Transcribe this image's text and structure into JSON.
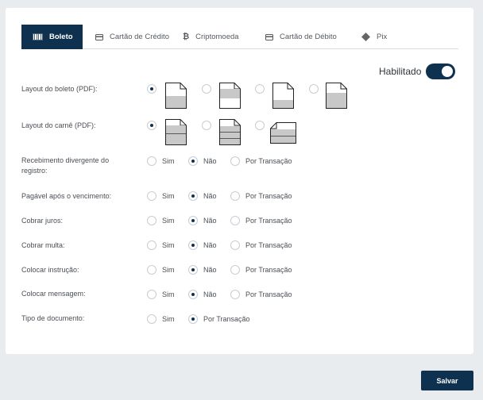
{
  "tabs": [
    {
      "label": "Boleto",
      "icon": "barcode-icon",
      "active": true
    },
    {
      "label": "Cartão de Crédito",
      "icon": "credit-card-icon",
      "active": false
    },
    {
      "label": "Criptomoeda",
      "icon": "bitcoin-icon",
      "active": false
    },
    {
      "label": "Cartão de Débito",
      "icon": "debit-card-icon",
      "active": false
    },
    {
      "label": "Pix",
      "icon": "pix-icon",
      "active": false
    }
  ],
  "status": {
    "label": "Habilitado",
    "enabled": true
  },
  "layout_boleto": {
    "label": "Layout do boleto (PDF):",
    "selected_index": 0
  },
  "layout_carne": {
    "label": "Layout do carnê (PDF):",
    "selected_index": 0
  },
  "options": {
    "sim": "Sim",
    "nao": "Não",
    "por_transacao": "Por Transação"
  },
  "rows": [
    {
      "label": "Recebimento divergente do registro:",
      "selected": "nao"
    },
    {
      "label": "Pagável após o vencimento:",
      "selected": "nao"
    },
    {
      "label": "Cobrar juros:",
      "selected": "nao"
    },
    {
      "label": "Cobrar multa:",
      "selected": "nao"
    },
    {
      "label": "Colocar instrução:",
      "selected": "nao"
    },
    {
      "label": "Colocar mensagem:",
      "selected": "nao"
    },
    {
      "label": "Tipo de documento:",
      "selected": "por_transacao"
    }
  ],
  "save_label": "Salvar",
  "colors": {
    "primary": "#0e3150",
    "background": "#e9ecef"
  }
}
